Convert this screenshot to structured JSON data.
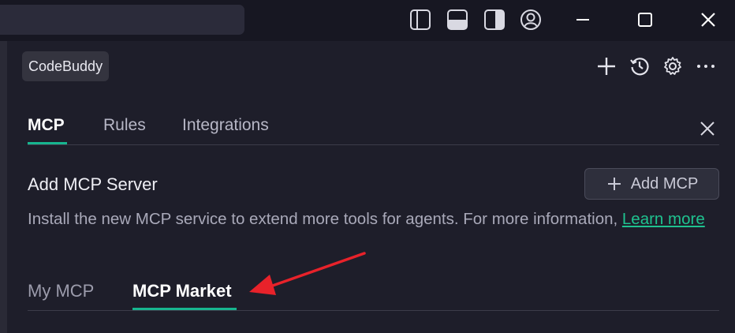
{
  "window": {
    "controls": [
      "minimize-icon",
      "maximize-icon",
      "close-icon"
    ],
    "layout_toggles": [
      "toggle-primary-sidebar-icon",
      "toggle-panel-icon",
      "toggle-secondary-sidebar-icon",
      "account-icon"
    ]
  },
  "panel": {
    "name": "CodeBuddy",
    "actions": [
      "new-chat-icon",
      "history-icon",
      "settings-icon",
      "more-icon"
    ]
  },
  "tabs": [
    {
      "label": "MCP",
      "active": true
    },
    {
      "label": "Rules",
      "active": false
    },
    {
      "label": "Integrations",
      "active": false
    }
  ],
  "mcp": {
    "title": "Add MCP Server",
    "add_button": "Add MCP",
    "description": "Install the new MCP service to extend more tools for agents. For more information,",
    "learn_more": "Learn more"
  },
  "subtabs": [
    {
      "label": "My MCP",
      "active": false
    },
    {
      "label": "MCP Market",
      "active": true
    }
  ],
  "colors": {
    "accent": "#17b58f",
    "link": "#1fc28f",
    "annotation_arrow": "#e8222a",
    "background": "#1e1e2a"
  }
}
